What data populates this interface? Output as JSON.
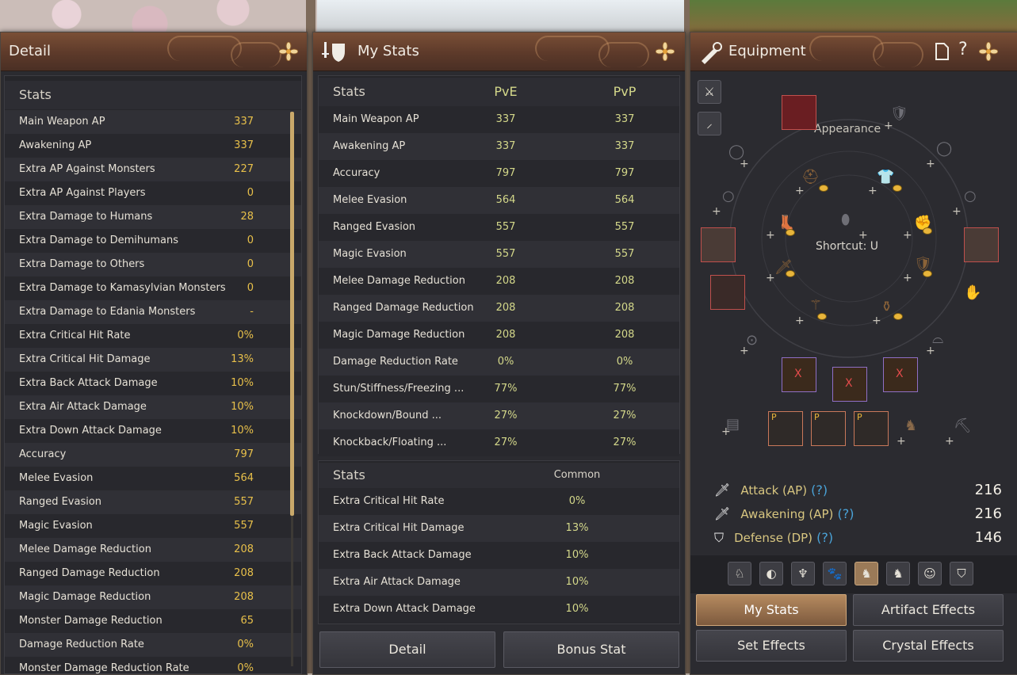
{
  "detail": {
    "title": "Detail",
    "header": "Stats",
    "rows": [
      {
        "label": "Main Weapon AP",
        "value": "337"
      },
      {
        "label": "Awakening AP",
        "value": "337"
      },
      {
        "label": "Extra AP Against Monsters",
        "value": "227"
      },
      {
        "label": "Extra AP Against Players",
        "value": "0"
      },
      {
        "label": "Extra Damage to Humans",
        "value": "28"
      },
      {
        "label": "Extra Damage to Demihumans",
        "value": "0"
      },
      {
        "label": "Extra Damage to Others",
        "value": "0"
      },
      {
        "label": "Extra Damage to Kamasylvian Monsters",
        "value": "0"
      },
      {
        "label": "Extra Damage to Edania Monsters",
        "value": "-"
      },
      {
        "label": "Extra Critical Hit Rate",
        "value": "0%"
      },
      {
        "label": "Extra Critical Hit Damage",
        "value": "13%"
      },
      {
        "label": "Extra Back Attack Damage",
        "value": "10%"
      },
      {
        "label": "Extra Air Attack Damage",
        "value": "10%"
      },
      {
        "label": "Extra Down Attack Damage",
        "value": "10%"
      },
      {
        "label": "Accuracy",
        "value": "797"
      },
      {
        "label": "Melee Evasion",
        "value": "564"
      },
      {
        "label": "Ranged Evasion",
        "value": "557"
      },
      {
        "label": "Magic Evasion",
        "value": "557"
      },
      {
        "label": "Melee Damage Reduction",
        "value": "208"
      },
      {
        "label": "Ranged Damage Reduction",
        "value": "208"
      },
      {
        "label": "Magic Damage Reduction",
        "value": "208"
      },
      {
        "label": "Monster Damage Reduction",
        "value": "65"
      },
      {
        "label": "Damage Reduction Rate",
        "value": "0%"
      },
      {
        "label": "Monster Damage Reduction Rate",
        "value": "0%"
      }
    ]
  },
  "mystats": {
    "title": "My Stats",
    "header": {
      "stats": "Stats",
      "pve": "PvE",
      "pvp": "PvP"
    },
    "rows": [
      {
        "label": "Main Weapon AP",
        "pve": "337",
        "pvp": "337"
      },
      {
        "label": "Awakening AP",
        "pve": "337",
        "pvp": "337"
      },
      {
        "label": "Accuracy",
        "pve": "797",
        "pvp": "797"
      },
      {
        "label": "Melee Evasion",
        "pve": "564",
        "pvp": "564"
      },
      {
        "label": "Ranged Evasion",
        "pve": "557",
        "pvp": "557"
      },
      {
        "label": "Magic Evasion",
        "pve": "557",
        "pvp": "557"
      },
      {
        "label": "Melee Damage Reduction",
        "pve": "208",
        "pvp": "208"
      },
      {
        "label": "Ranged Damage Reduction",
        "pve": "208",
        "pvp": "208"
      },
      {
        "label": "Magic Damage Reduction",
        "pve": "208",
        "pvp": "208"
      },
      {
        "label": "Damage Reduction Rate",
        "pve": "0%",
        "pvp": "0%"
      },
      {
        "label": "Stun/Stiffness/Freezing ...",
        "pve": "77%",
        "pvp": "77%"
      },
      {
        "label": "Knockdown/Bound ...",
        "pve": "27%",
        "pvp": "27%"
      },
      {
        "label": "Knockback/Floating ...",
        "pve": "27%",
        "pvp": "27%"
      }
    ],
    "common_header": {
      "stats": "Stats",
      "common": "Common"
    },
    "common_rows": [
      {
        "label": "Extra Critical Hit Rate",
        "value": "0%"
      },
      {
        "label": "Extra Critical Hit Damage",
        "value": "13%"
      },
      {
        "label": "Extra Back Attack Damage",
        "value": "10%"
      },
      {
        "label": "Extra Air Attack Damage",
        "value": "10%"
      },
      {
        "label": "Extra Down Attack Damage",
        "value": "10%"
      }
    ],
    "buttons": {
      "detail": "Detail",
      "bonus": "Bonus Stat"
    }
  },
  "equipment": {
    "title": "Equipment",
    "appearance_label": "Appearance",
    "shortcut_label": "Shortcut: U",
    "p_badge": "P",
    "x_mark": "X",
    "attack": {
      "label": "Attack (AP)",
      "value": "216"
    },
    "awakening": {
      "label": "Awakening (AP)",
      "value": "216"
    },
    "defense": {
      "label": "Defense (DP)",
      "value": "146"
    },
    "help_mark": "(?)",
    "buttons": {
      "mystats": "My Stats",
      "artifact": "Artifact Effects",
      "set": "Set Effects",
      "crystal": "Crystal Effects"
    },
    "icons": [
      "document-icon",
      "help-icon",
      "flower-icon"
    ]
  }
}
